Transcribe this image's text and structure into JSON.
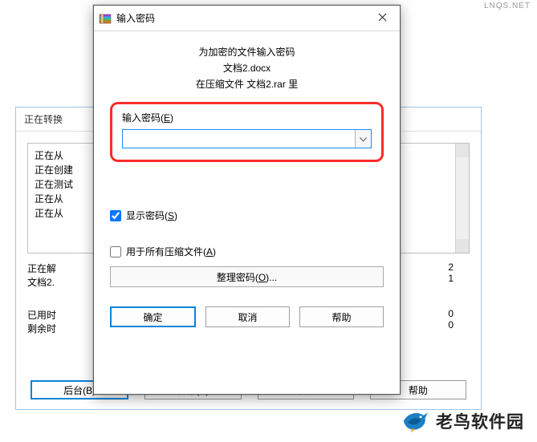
{
  "watermark": "LNQS.NET",
  "bg_window": {
    "title": "正在转换",
    "lines": [
      "正在从",
      "正在创建",
      "正在测试",
      "正在从",
      "正在从"
    ],
    "extracting_label": "正在解",
    "file_label": "文档2.",
    "count_2": "2",
    "count_1": "1",
    "elapsed_label": "已用时",
    "elapsed_val": "0",
    "remain_label": "剩余时",
    "remain_val": "0",
    "btn_bg": "后台(B)",
    "btn_pause": "暂停(P)",
    "btn_cancel": "取消",
    "btn_help": "帮助"
  },
  "dialog": {
    "title": "输入密码",
    "line1": "为加密的文件输入密码",
    "line2": "文档2.docx",
    "line3": "在压缩文件 文档2.rar 里",
    "password_label_pre": "输入密码(",
    "password_label_key": "E",
    "password_label_post": ")",
    "password_value": "",
    "show_pwd_pre": "显示密码(",
    "show_pwd_key": "S",
    "show_pwd_post": ")",
    "apply_all_pre": "用于所有压缩文件(",
    "apply_all_key": "A",
    "apply_all_post": ")",
    "manage_pre": "整理密码(",
    "manage_key": "O",
    "manage_post": ")...",
    "ok": "确定",
    "cancel": "取消",
    "help": "帮助"
  },
  "brand": "老鸟软件园"
}
